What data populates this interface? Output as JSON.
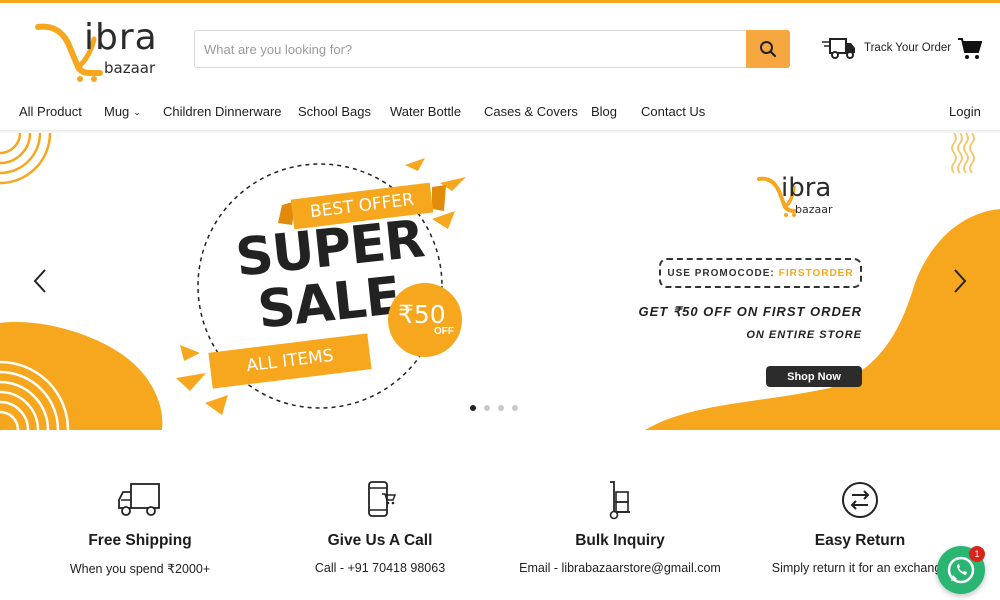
{
  "brand": {
    "name": "ibra",
    "sub": "bazaar",
    "accent": "#f6a71e"
  },
  "search": {
    "placeholder": "What are you looking for?",
    "icon": "search-icon"
  },
  "header": {
    "track_label": "Track Your Order",
    "track_icon": "delivery-truck-icon",
    "cart_icon": "cart-icon"
  },
  "nav": {
    "items": [
      {
        "label": "All Product"
      },
      {
        "label": "Mug",
        "has_dropdown": true
      },
      {
        "label": "Children Dinnerware"
      },
      {
        "label": "School Bags"
      },
      {
        "label": "Water Bottle"
      },
      {
        "label": "Cases & Covers"
      },
      {
        "label": "Blog"
      },
      {
        "label": "Contact Us"
      }
    ],
    "login": "Login"
  },
  "banner": {
    "ribbon_top": "BEST OFFER",
    "headline_1": "SUPER",
    "headline_2": "SALE",
    "ribbon_bottom": "ALL ITEMS",
    "price": "₹50",
    "price_suffix": "OFF",
    "logo_text": "ibra",
    "logo_sub": "bazaar",
    "promo_prefix": "USE PROMOCODE:",
    "promo_code": "FIRSTORDER",
    "offer_line": "GET ₹50 OFF ON FIRST ORDER",
    "offer_sub": "ON ENTIRE STORE",
    "cta": "Shop Now",
    "slides": 4,
    "active_slide": 1
  },
  "features": [
    {
      "icon": "truck-icon",
      "title": "Free Shipping",
      "desc": "When you spend ₹2000+"
    },
    {
      "icon": "phone-icon",
      "title": "Give Us A Call",
      "desc": "Call - +91 70418 98063"
    },
    {
      "icon": "hand-truck-icon",
      "title": "Bulk Inquiry",
      "desc": "Email - librabazaarstore@gmail.com"
    },
    {
      "icon": "return-icon",
      "title": "Easy Return",
      "desc": "Simply return it for an exchange"
    }
  ],
  "chat": {
    "icon": "whatsapp-icon",
    "badge": "1",
    "color": "#2bb573"
  }
}
